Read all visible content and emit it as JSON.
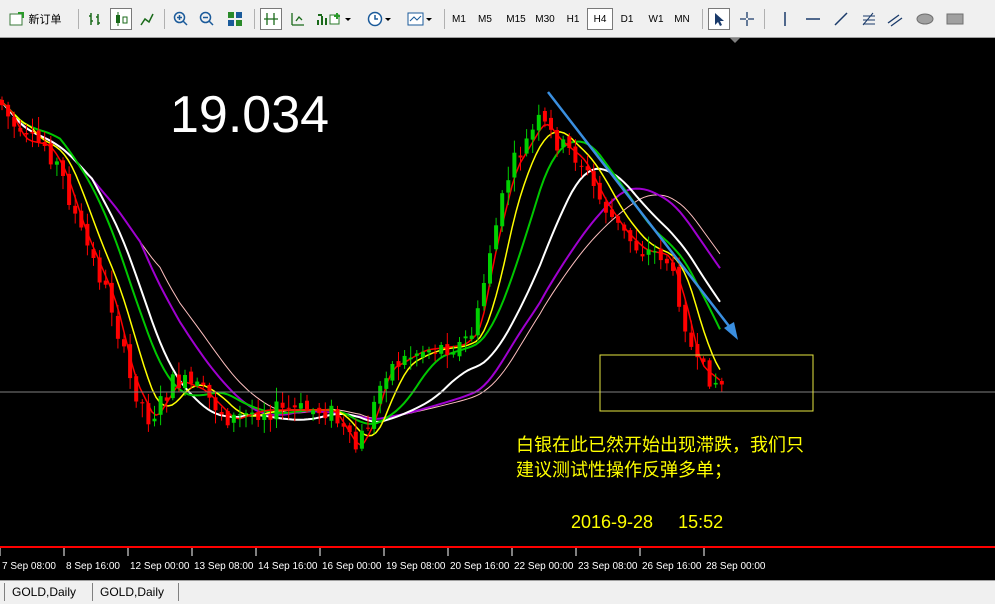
{
  "toolbar": {
    "new_order_label": "新订单",
    "timeframes": [
      "M1",
      "M5",
      "M15",
      "M30",
      "H1",
      "H4",
      "D1",
      "W1",
      "MN"
    ],
    "active_timeframe": "H4",
    "icons": [
      "new-order-icon",
      "bar-chart-icon",
      "candlestick-icon",
      "line-chart-icon",
      "zoom-in-icon",
      "zoom-out-icon",
      "tile-windows-icon",
      "period-separator-icon",
      "grid-icon",
      "volumes-icon",
      "indicators-icon",
      "clock-icon",
      "templates-icon",
      "cursor-icon",
      "crosshair-icon",
      "vertical-line-icon",
      "horizontal-line-icon",
      "trendline-icon",
      "fibonacci-icon",
      "ellipse-icon",
      "rectangle-icon"
    ]
  },
  "chart": {
    "price_label": "19.034",
    "note_line1": "白银在此已然开始出现滞跌，我们只",
    "note_line2": "建议测试性操作反弹多单；",
    "timestamp": "2016-9-28     15:52",
    "x_ticks": [
      "7 Sep 08:00",
      "8 Sep 16:00",
      "12 Sep 00:00",
      "13 Sep 08:00",
      "14 Sep 16:00",
      "16 Sep 00:00",
      "19 Sep 08:00",
      "20 Sep 16:00",
      "22 Sep 00:00",
      "23 Sep 08:00",
      "26 Sep 16:00",
      "28 Sep 00:00"
    ],
    "colors": {
      "background": "#000000",
      "bull": "#00d000",
      "bear": "#ff0000",
      "ma_red": "#ff0000",
      "ma_yellow": "#ffff00",
      "ma_green": "#00c800",
      "ma_white": "#ffffff",
      "ma_purple": "#a000d0",
      "ma_pink": "#ffc0c0",
      "trendline": "#3a8fe0",
      "box": "#e6e640",
      "note_text": "#ffff00"
    }
  },
  "tabs": [
    "GOLD,Daily",
    "GOLD,Daily"
  ],
  "chart_data": {
    "type": "candlestick",
    "title": "",
    "x": [
      "7 Sep 08:00",
      "8 Sep 16:00",
      "12 Sep 00:00",
      "13 Sep 08:00",
      "14 Sep 16:00",
      "16 Sep 00:00",
      "19 Sep 08:00",
      "20 Sep 16:00",
      "22 Sep 00:00",
      "23 Sep 08:00",
      "26 Sep 16:00",
      "28 Sep 00:00"
    ],
    "series": [
      {
        "values": [
          160,
          150,
          180,
          250,
          330,
          390,
          380,
          350,
          150,
          190,
          270,
          380
        ]
      }
    ],
    "annotations": [
      "19.034",
      "白银在此已然开始出现滞跌，我们只",
      "建议测试性操作反弹多单；",
      "2016-9-28     15:52"
    ]
  }
}
